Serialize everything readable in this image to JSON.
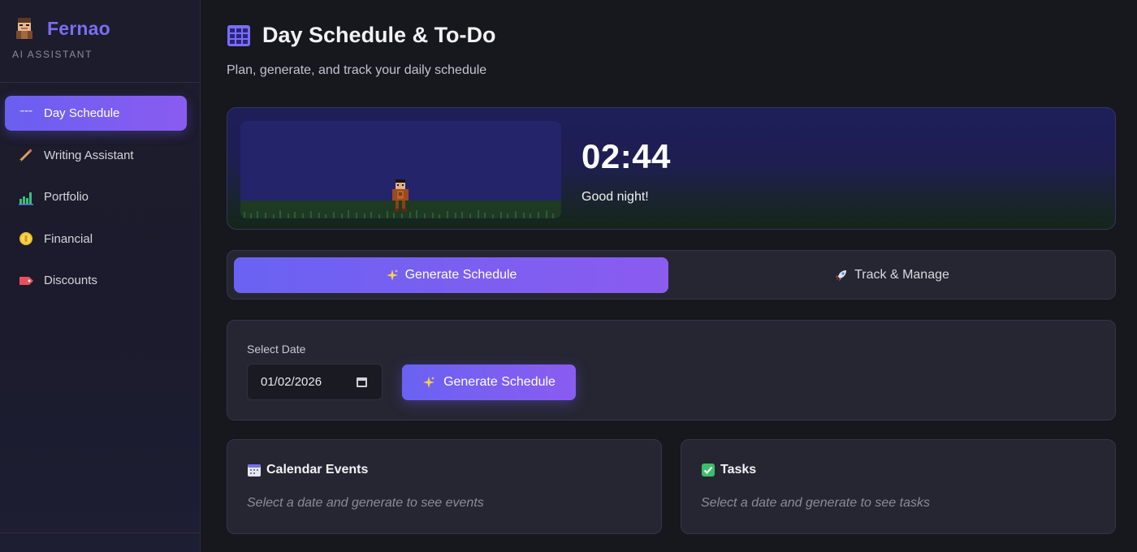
{
  "sidebar": {
    "brand_name": "Fernao",
    "brand_subtitle": "AI ASSISTANT",
    "items": [
      {
        "label": "Day Schedule",
        "icon": "calendar-icon",
        "active": true
      },
      {
        "label": "Writing Assistant",
        "icon": "pencil-icon",
        "active": false
      },
      {
        "label": "Portfolio",
        "icon": "chart-icon",
        "active": false
      },
      {
        "label": "Financial",
        "icon": "coin-icon",
        "active": false
      },
      {
        "label": "Discounts",
        "icon": "tag-icon",
        "active": false
      }
    ]
  },
  "header": {
    "title": "Day Schedule & To-Do",
    "subtitle": "Plan, generate, and track your daily schedule"
  },
  "hero": {
    "time": "02:44",
    "greeting": "Good night!"
  },
  "tabs": [
    {
      "label": "Generate Schedule",
      "icon": "sparkles-icon",
      "active": true
    },
    {
      "label": "Track & Manage",
      "icon": "rocket-icon",
      "active": false
    }
  ],
  "controls": {
    "date_label": "Select Date",
    "date_value": "01/02/2026",
    "generate_label": "Generate Schedule"
  },
  "cards": {
    "calendar": {
      "title": "Calendar Events",
      "empty": "Select a date and generate to see events"
    },
    "tasks": {
      "title": "Tasks",
      "empty": "Select a date and generate to see tasks"
    }
  },
  "colors": {
    "accent": "#7c6cf2",
    "accent_gradient_end": "#8a5cf0",
    "background": "#17171e",
    "panel": "#262632"
  }
}
